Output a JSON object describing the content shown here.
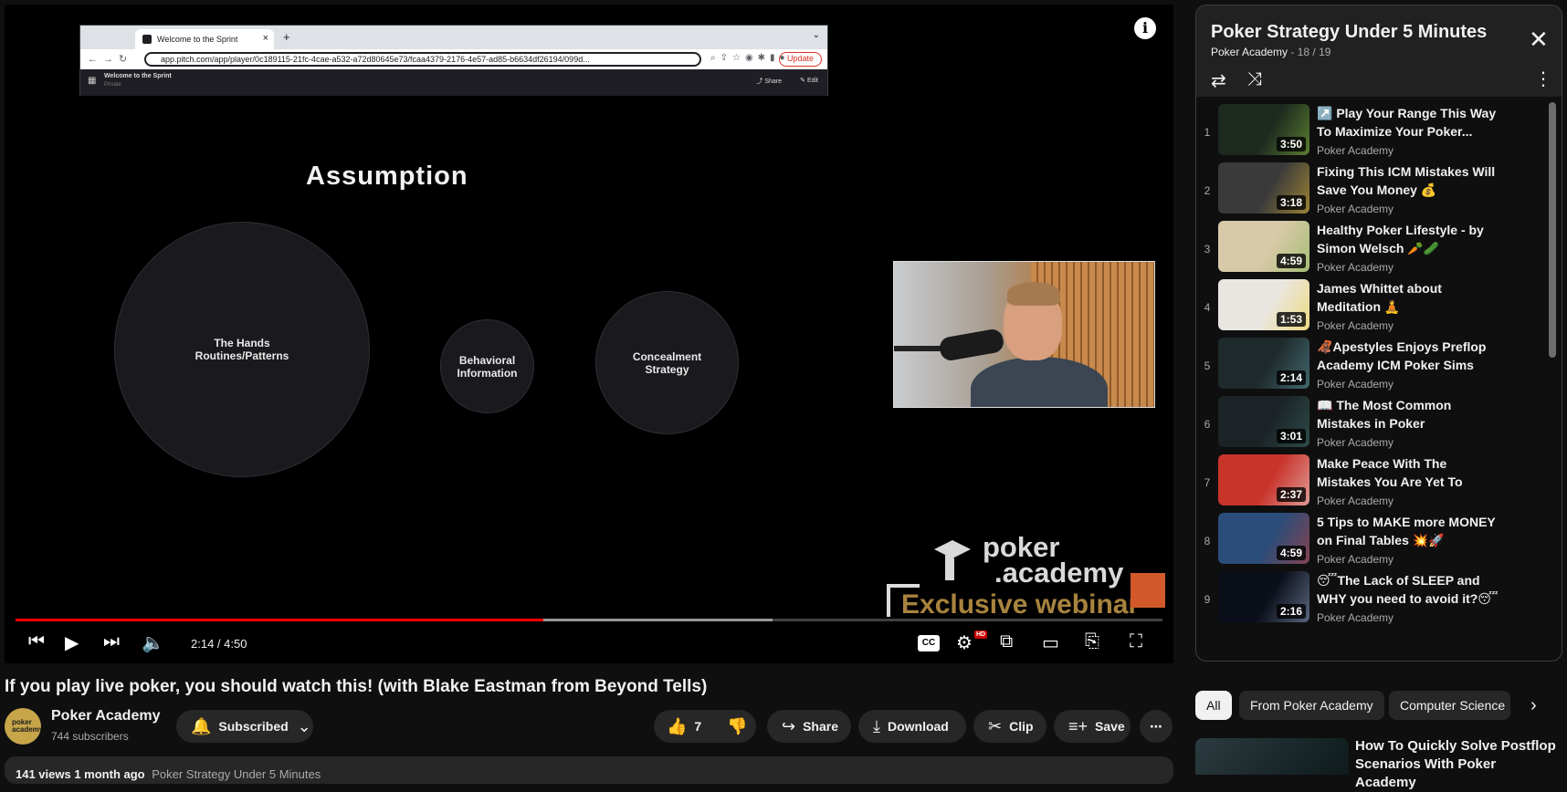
{
  "video": {
    "title": "If you play live poker, you should watch this! (with Blake Eastman from Beyond Tells)",
    "time": "2:14 / 4:50",
    "progress_fraction": 0.46,
    "hd_badge": "HD",
    "cc_label": "CC"
  },
  "screen_share": {
    "tab_title": "Welcome to the Sprint",
    "url": "app.pitch.com/app/player/0c189115-21fc-4cae-a532-a72d80645e73/fcaa4379-2176-4e57-ad85-b6634df26194/099d...",
    "update_label": "Update",
    "doc_title": "Welcome to the Sprint",
    "doc_sub": "Private",
    "share_label": "Share",
    "edit_label": "Edit"
  },
  "slide": {
    "title": "Assumption",
    "bubbles": [
      {
        "text": "The Hands\nRoutines/Patterns"
      },
      {
        "text": "Behavioral\nInformation"
      },
      {
        "text": "Concealment\nStrategy"
      }
    ]
  },
  "watermark": {
    "brand_line1": "poker",
    "brand_line2": ".academy",
    "banner": "Exclusive webinar"
  },
  "channel": {
    "name": "Poker Academy",
    "subscribers": "744 subscribers",
    "avatar_text": "poker\nacademy"
  },
  "actions": {
    "subscribed": "Subscribed",
    "likes": "7",
    "share": "Share",
    "download": "Download",
    "clip": "Clip",
    "save": "Save"
  },
  "description": {
    "meta": "141 views  1 month ago",
    "playlist_link": "Poker Strategy Under 5 Minutes"
  },
  "playlist": {
    "title": "Poker Strategy Under 5 Minutes",
    "channel": "Poker Academy",
    "position": "- 18 / 19",
    "items": [
      {
        "num": "1",
        "title": "↗️ Play Your Range This Way To Maximize Your Poker...",
        "channel": "Poker Academy",
        "duration": "3:50",
        "thumb_color": "#1d2a1f",
        "thumb_accent": "#8ec63f"
      },
      {
        "num": "2",
        "title": "Fixing This ICM Mistakes Will Save You Money 💰",
        "channel": "Poker Academy",
        "duration": "3:18",
        "thumb_color": "#3a3a3a",
        "thumb_accent": "#f2c230"
      },
      {
        "num": "3",
        "title": "Healthy Poker Lifestyle - by Simon Welsch 🥕🥒",
        "channel": "Poker Academy",
        "duration": "4:59",
        "thumb_color": "#d8c9a8",
        "thumb_accent": "#7ab648"
      },
      {
        "num": "4",
        "title": "James Whittet about Meditation 🧘",
        "channel": "Poker Academy",
        "duration": "1:53",
        "thumb_color": "#e9e6e1",
        "thumb_accent": "#f2d230"
      },
      {
        "num": "5",
        "title": "🦧Apestyles Enjoys Preflop Academy ICM Poker Sims",
        "channel": "Poker Academy",
        "duration": "2:14",
        "thumb_color": "#1f2a2c",
        "thumb_accent": "#5fa0a8"
      },
      {
        "num": "6",
        "title": "📖 The Most Common Mistakes in Poker Tournament",
        "channel": "Poker Academy",
        "duration": "3:01",
        "thumb_color": "#1b2326",
        "thumb_accent": "#3e6e6a"
      },
      {
        "num": "7",
        "title": "Make Peace With The Mistakes You Are Yet To Mak...",
        "channel": "Poker Academy",
        "duration": "2:37",
        "thumb_color": "#c8332a",
        "thumb_accent": "#f4f4f4"
      },
      {
        "num": "8",
        "title": "5 Tips to MAKE more MONEY on Final Tables 💥🚀",
        "channel": "Poker Academy",
        "duration": "4:59",
        "thumb_color": "#2a4d7a",
        "thumb_accent": "#d23a2a"
      },
      {
        "num": "9",
        "title": "😴The Lack of SLEEP and WHY you need to avoid it?😴",
        "channel": "Poker Academy",
        "duration": "2:16",
        "thumb_color": "#0b0f1a",
        "thumb_accent": "#9fb3d8"
      }
    ]
  },
  "chips": {
    "all": "All",
    "from_channel": "From Poker Academy",
    "computer_science": "Computer Science"
  },
  "recommendation": {
    "title": "How To Quickly Solve Postflop Scenarios With Poker Academy"
  },
  "colors": {
    "accent": "#ff0000",
    "background": "#0f0f0f",
    "surface": "#272727"
  }
}
